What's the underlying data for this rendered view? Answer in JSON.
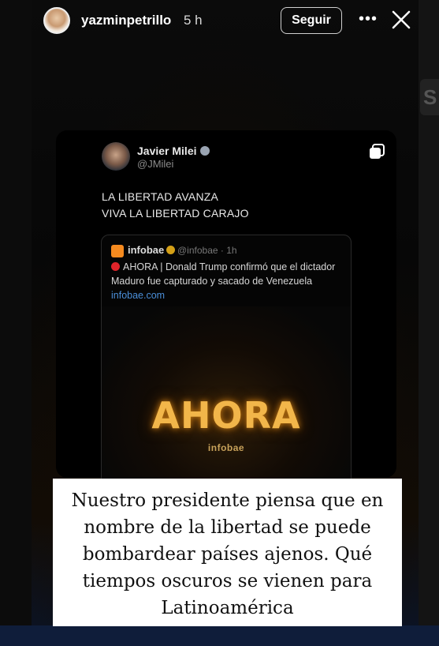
{
  "story": {
    "username": "yazminpetrillo",
    "time_ago": "5 h",
    "follow_label": "Seguir",
    "more_icon": "more-icon",
    "close_icon": "close-icon"
  },
  "tweet": {
    "author_name": "Javier Milei",
    "author_handle": "@JMilei",
    "lines": [
      "LA LIBERTAD AVANZA",
      "VIVA LA LIBERTAD CARAJO"
    ],
    "quote": {
      "source_name": "infobae",
      "meta": "@infobae · 1h",
      "text": "AHORA | Donald Trump confirmó que el dictador Maduro fue capturado y sacado de Venezuela",
      "link": "infobae.com",
      "media_title": "AHORA",
      "media_sub": "infobae"
    }
  },
  "caption": {
    "lines": [
      "Nuestro presidente piensa que en",
      "nombre de la libertad se puede",
      "bombardear países ajenos. Qué",
      "tiempos oscuros se vienen para",
      "Latinoamérica"
    ]
  },
  "colors": {
    "caption_bg": "#ffffff",
    "link": "#4a8ed8",
    "media_text": "#f2b64a",
    "infobae_orange": "#f58a1f"
  }
}
